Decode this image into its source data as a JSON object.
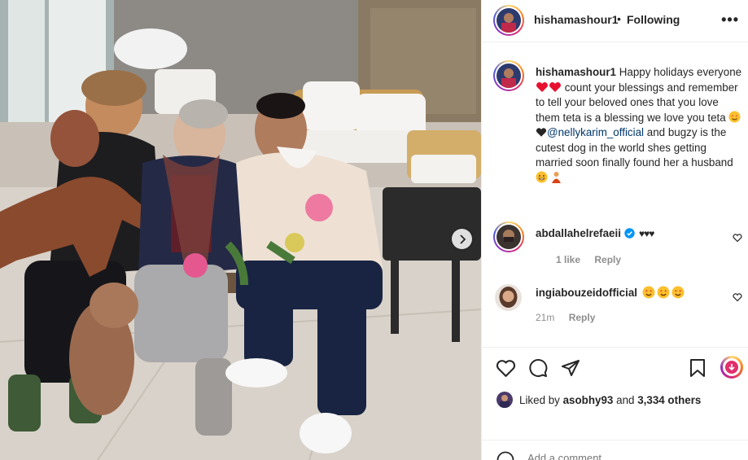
{
  "header": {
    "username": "hishamashour1",
    "separator": "•",
    "follow_status": "Following",
    "more_label": "•••"
  },
  "caption": {
    "username": "hishamashour1",
    "text_1": "Happy holidays everyone",
    "text_2": "count your blessings and remember to tell your beloved ones that you love them teta is a blessing we love you teta",
    "mention": "@nellykarim_official",
    "text_3": "and bugzy is the cutest dog in the world shes getting married soon finally found her a husband"
  },
  "comments": [
    {
      "username": "abdallahelrefaeii",
      "text": "♥♥♥",
      "likes": "1 like",
      "reply": "Reply",
      "verified": true
    },
    {
      "username": "ingiabouzeidofficial",
      "text": "",
      "time": "21m",
      "reply": "Reply",
      "verified": false
    }
  ],
  "likes": {
    "prefix": "Liked by",
    "user": "asobhy93",
    "middle": "and",
    "count": "3,334 others"
  },
  "add_comment": {
    "placeholder": "Add a comment..."
  },
  "icons": {
    "more": "more-icon",
    "verified": "verified-badge-icon",
    "heart": "heart-icon",
    "comment": "comment-icon",
    "share": "share-icon",
    "save": "bookmark-icon",
    "next": "chevron-right-icon",
    "emoji": "smile-icon"
  },
  "colors": {
    "text": "#262626",
    "muted": "#8e8e8e",
    "mention": "#00376b",
    "verified": "#0095f6",
    "border": "#efefef"
  }
}
